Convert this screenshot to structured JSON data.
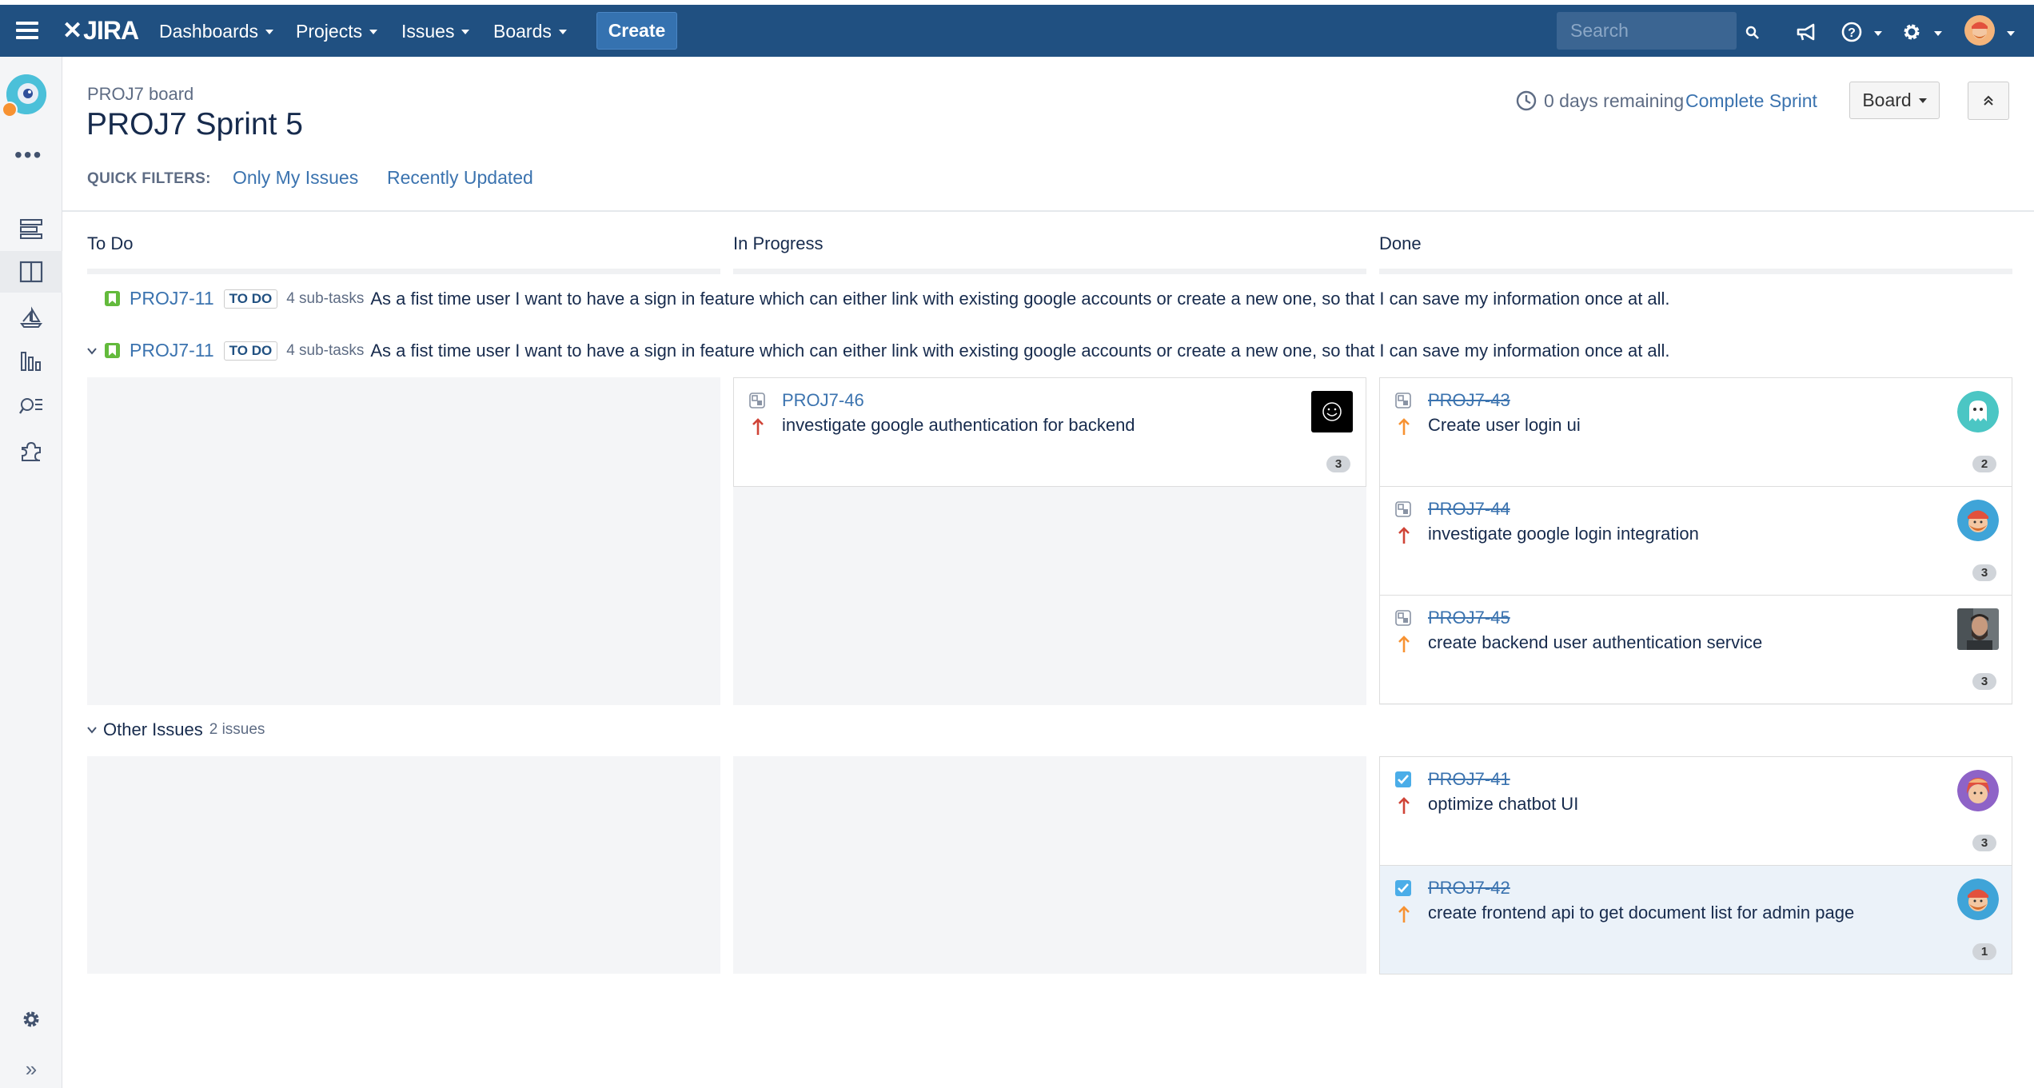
{
  "topbar": {
    "logo": "JIRA",
    "menus": [
      "Dashboards",
      "Projects",
      "Issues",
      "Boards"
    ],
    "create_label": "Create",
    "search_placeholder": "Search"
  },
  "header": {
    "board_name": "PROJ7 board",
    "sprint_title": "PROJ7 Sprint 5",
    "days_remaining": "0 days remaining",
    "complete_sprint": "Complete Sprint",
    "board_button": "Board",
    "quick_filters_label": "QUICK FILTERS:",
    "quick_filters": [
      "Only My Issues",
      "Recently Updated"
    ]
  },
  "columns": [
    "To Do",
    "In Progress",
    "Done"
  ],
  "swimlanes": [
    {
      "key": "PROJ7-11",
      "status": "TO DO",
      "subtasks": "4 sub-tasks",
      "summary": "As a fist time user I want to have a sign in feature which can either link with existing google accounts or create a new one, so that I can save my information once at all."
    },
    {
      "key": "PROJ7-11",
      "status": "TO DO",
      "subtasks": "4 sub-tasks",
      "summary": "As a fist time user I want to have a sign in feature which can either link with existing google accounts or create a new one, so that I can save my information once at all."
    }
  ],
  "cards": {
    "in_progress": [
      {
        "key": "PROJ7-46",
        "summary": "investigate google authentication for backend",
        "estimate": "3",
        "priority": "high",
        "type": "subtask",
        "avatar": "dark-smiley"
      }
    ],
    "done": [
      {
        "key": "PROJ7-43",
        "summary": "Create user login ui",
        "estimate": "2",
        "priority": "medium",
        "type": "subtask",
        "avatar": "teal-ghost"
      },
      {
        "key": "PROJ7-44",
        "summary": "investigate google login integration",
        "estimate": "3",
        "priority": "high",
        "type": "subtask",
        "avatar": "orange-beard"
      },
      {
        "key": "PROJ7-45",
        "summary": "create backend user authentication service",
        "estimate": "3",
        "priority": "medium",
        "type": "subtask",
        "avatar": "photo-man"
      }
    ]
  },
  "other_issues": {
    "title": "Other Issues",
    "count": "2 issues",
    "done": [
      {
        "key": "PROJ7-41",
        "summary": "optimize chatbot UI",
        "estimate": "3",
        "priority": "high",
        "type": "task",
        "avatar": "purple-girl"
      },
      {
        "key": "PROJ7-42",
        "summary": "create frontend api to get document list for admin page",
        "estimate": "1",
        "priority": "medium",
        "type": "task",
        "avatar": "orange-beard"
      }
    ]
  },
  "colors": {
    "topbar": "#205081",
    "link": "#3b73af",
    "story": "#63ba3c",
    "priority_high": "#d04437",
    "priority_medium": "#f79232"
  }
}
